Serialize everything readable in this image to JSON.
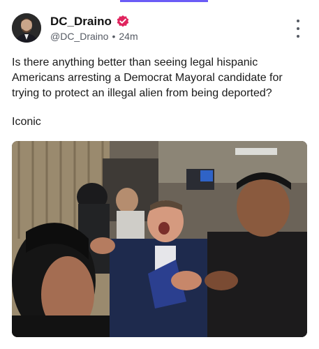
{
  "top_indicator_color": "#6b5cf6",
  "post": {
    "author": {
      "display_name": "DC_Draino",
      "handle": "@DC_Draino",
      "verified": true,
      "verified_badge_color": "#e0245e"
    },
    "timestamp": "24m",
    "separator": "•",
    "text": "Is there anything better than seeing legal hispanic Americans arresting a Democrat Mayoral candidate for trying to protect an illegal alien from being deported?",
    "tagline": "Iconic",
    "more_icon": "more-vertical-icon",
    "media": {
      "type": "photo"
    }
  }
}
